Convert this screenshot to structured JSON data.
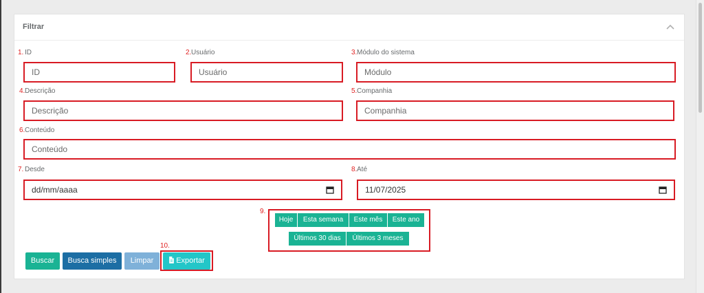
{
  "panel": {
    "title": "Filtrar"
  },
  "fields": {
    "id": {
      "number": "1.",
      "label": "ID",
      "placeholder": "ID"
    },
    "usuario": {
      "number": "2.",
      "label": "Usuário",
      "placeholder": "Usuário"
    },
    "modulo": {
      "number": "3.",
      "label": "Módulo do sistema",
      "placeholder": "Módulo"
    },
    "descricao": {
      "number": "4.",
      "label": "Descrição",
      "placeholder": "Descrição"
    },
    "companhia": {
      "number": "5.",
      "label": "Companhia",
      "placeholder": "Companhia"
    },
    "conteudo": {
      "number": "6.",
      "label": "Conteúdo",
      "placeholder": "Conteúdo"
    },
    "desde": {
      "number": "7.",
      "label": "Desde",
      "value": "dd/mm/aaaa"
    },
    "ate": {
      "number": "8.",
      "label": "Até",
      "value": "11/07/2025"
    }
  },
  "quick_dates": {
    "number": "9.",
    "row1": [
      "Hoje",
      "Esta semana",
      "Este mês",
      "Este ano"
    ],
    "row2": [
      "Últimos 30 dias",
      "Últimos 3 meses"
    ]
  },
  "actions": {
    "export_number": "10.",
    "buscar": "Buscar",
    "busca_simples": "Busca simples",
    "limpar": "Limpar",
    "exportar": "Exportar"
  },
  "colors": {
    "primary_green": "#1ab394",
    "primary_blue": "#1c6ea4",
    "light_blue": "#7fb1d9",
    "cyan": "#23c6c8",
    "annotation_red": "#d81a23"
  },
  "icons": {
    "collapse": "chevron-up-icon",
    "calendar": "calendar-icon",
    "export": "file-icon"
  }
}
